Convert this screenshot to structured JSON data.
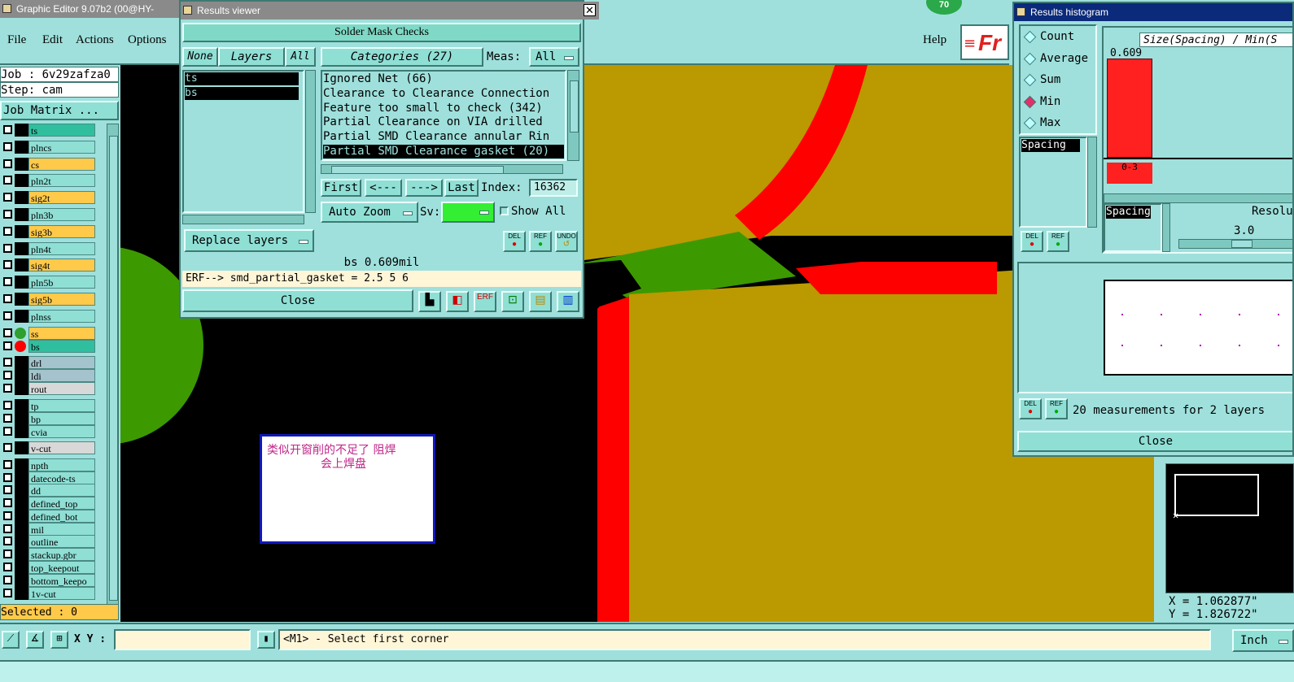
{
  "main_window": {
    "title": "Graphic Editor 9.07b2 (00@HY-HYCA",
    "menu": [
      "File",
      "Edit",
      "Actions",
      "Options"
    ],
    "help_label": "Help",
    "logo_text": "Fr",
    "badge_value": "70"
  },
  "job_panel": {
    "job_label": "Job : 6v29zafza0",
    "step_label": "Step: cam",
    "job_matrix_label": "Job Matrix ...",
    "layers": [
      {
        "name": "ts",
        "color": "#2fbf9f"
      },
      {
        "name": "plncs",
        "color": "#8fdfd5"
      },
      {
        "name": "cs",
        "color": "#ffc94a"
      },
      {
        "name": "pln2t",
        "color": "#8fdfd5"
      },
      {
        "name": "sig2t",
        "color": "#ffc94a"
      },
      {
        "name": "pln3b",
        "color": "#8fdfd5"
      },
      {
        "name": "sig3b",
        "color": "#ffc94a"
      },
      {
        "name": "pln4t",
        "color": "#8fdfd5"
      },
      {
        "name": "sig4t",
        "color": "#ffc94a"
      },
      {
        "name": "pln5b",
        "color": "#8fdfd5"
      },
      {
        "name": "sig5b",
        "color": "#ffc94a"
      },
      {
        "name": "plnss",
        "color": "#8fdfd5"
      },
      {
        "name": "ss",
        "color": "#ffc94a",
        "dot": "#2f9f2f"
      },
      {
        "name": "bs",
        "color": "#2fbf9f",
        "dot": "#ff0000"
      },
      {
        "name": "drl",
        "color": "#a5c3cc"
      },
      {
        "name": "ldi",
        "color": "#a5c3cc"
      },
      {
        "name": "rout",
        "color": "#d8d8d8"
      },
      {
        "name": "tp",
        "color": "#8fdfd5"
      },
      {
        "name": "bp",
        "color": "#8fdfd5"
      },
      {
        "name": "cvia",
        "color": "#8fdfd5"
      },
      {
        "name": "v-cut",
        "color": "#d8d8d8"
      },
      {
        "name": "npth",
        "color": "#8fdfd5"
      },
      {
        "name": "datecode-ts",
        "color": "#8fdfd5"
      },
      {
        "name": "dd",
        "color": "#8fdfd5"
      },
      {
        "name": "defined_top",
        "color": "#8fdfd5"
      },
      {
        "name": "defined_bot",
        "color": "#8fdfd5"
      },
      {
        "name": "mil",
        "color": "#8fdfd5"
      },
      {
        "name": "outline",
        "color": "#8fdfd5"
      },
      {
        "name": "stackup.gbr",
        "color": "#8fdfd5"
      },
      {
        "name": "top_keepout",
        "color": "#8fdfd5"
      },
      {
        "name": "bottom_keepo",
        "color": "#8fdfd5"
      },
      {
        "name": "1v-cut",
        "color": "#8fdfd5"
      }
    ],
    "selected_label": "Selected : 0"
  },
  "results_viewer": {
    "title": "Results viewer",
    "header": "Solder Mask Checks",
    "none_label": "None",
    "layers_label": "Layers",
    "all_label": "All",
    "categories_label": "Categories (27)",
    "meas_label": "Meas:",
    "meas_value": "All",
    "layer_items": [
      "ts",
      "bs"
    ],
    "category_items": [
      "Ignored Net (66)",
      "Clearance to Clearance Connection",
      "Feature too small to check (342)",
      "Partial Clearance on VIA drilled",
      "Partial SMD Clearance annular Rin",
      "Partial SMD Clearance gasket (20)"
    ],
    "first_label": "First",
    "prev_label": "<---",
    "next_label": "--->",
    "last_label": "Last",
    "index_label": "Index:",
    "index_value": "16362",
    "auto_zoom_label": "Auto Zoom",
    "sv_label": "Sv:",
    "show_all_label": "Show All",
    "replace_layers_label": "Replace layers",
    "measure_text": "bs 0.609mil",
    "erf_text": "ERF--> smd_partial_gasket = 2.5 5 6",
    "close_label": "Close",
    "sv_color": "#33ee33"
  },
  "results_histogram": {
    "title": "Results histogram",
    "stats": [
      "Count",
      "Average",
      "Sum",
      "Min",
      "Max"
    ],
    "selected_stat": "Min",
    "axis_title": "Size(Spacing) / Min(S",
    "bar_value": "0.609",
    "bar_range": "0-3",
    "spacing_list_item": "Spacing",
    "spacing_select": "Spacing",
    "resolution_label": "Resolut",
    "resolution_value": "3.0",
    "summary": "20 measurements for 2 layers",
    "close_label": "Close"
  },
  "annotation": {
    "text_line1": "类似开窗削的不足了   阻焊",
    "text_line2": "会上焊盘"
  },
  "coords": {
    "x": "X = 1.062877\"",
    "y": "Y = 1.826722\""
  },
  "status_bar": {
    "xy_label": "X Y :",
    "xy_value": "",
    "prompt": "<M1> - Select first corner",
    "units": "Inch"
  },
  "colors": {
    "canvas_bg": "#000000",
    "copper": "#bb9900",
    "mask_red": "#ff0000",
    "green": "#3d9900",
    "ui_teal": "#9fe0dc"
  }
}
